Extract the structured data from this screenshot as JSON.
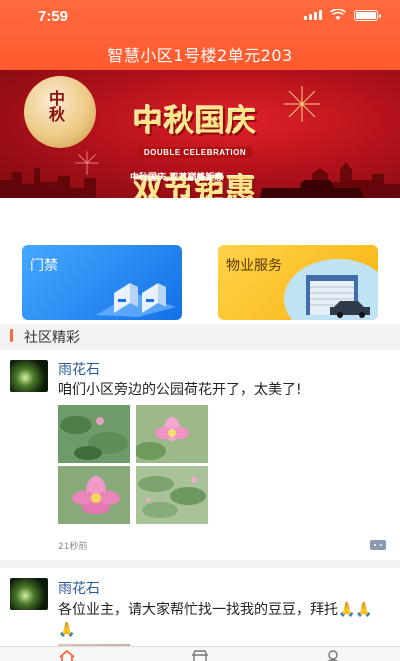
{
  "status_bar": {
    "time": "7:59"
  },
  "header": {
    "title": "智慧小区1号楼2单元203"
  },
  "banner": {
    "moon_text": "中秋",
    "line1": "中秋国庆",
    "english": "DOUBLE CELEBRATION",
    "line2": "双节钜惠",
    "subtitle": "中秋国庆,双节巅峰钜惠"
  },
  "services": [
    {
      "label": "门禁",
      "icon": "turnstile-gate-icon"
    },
    {
      "label": "物业服务",
      "icon": "garage-car-icon"
    }
  ],
  "section": {
    "title": "社区精彩"
  },
  "posts": [
    {
      "user": "雨花石",
      "text": "咱们小区旁边的公园荷花开了，太美了!",
      "time": "21秒前",
      "photos": [
        "lotus-leaves-photo",
        "pink-lotus-photo",
        "lotus-flower-photo",
        "lotus-pond-photo"
      ]
    },
    {
      "user": "雨花石",
      "text": "各位业主，请大家帮忙找一找我的豆豆，拜托🙏🙏🙏"
    }
  ],
  "tabbar": [
    "home-icon",
    "shop-icon",
    "profile-icon"
  ],
  "colors": {
    "header": "#ff5a2e",
    "door_card": "#1f7fee",
    "property_card": "#f9c024",
    "username": "#2a5a9a"
  }
}
